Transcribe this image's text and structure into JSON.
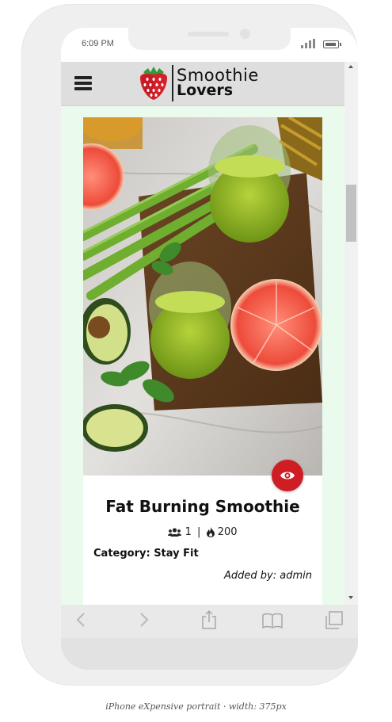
{
  "status": {
    "time": "6:09 PM"
  },
  "header": {
    "brand_line1": "Smoothie",
    "brand_line2": "Lovers",
    "menu_icon": "hamburger-icon",
    "logo_icon": "strawberry-icon"
  },
  "card": {
    "image_subject": "smoothie-jars-with-grapefruit-avocado-celery",
    "title": "Fat Burning Smoothie",
    "servings": "1",
    "separator": "|",
    "calories": "200",
    "category": "Category: Stay Fit",
    "added_by": "Added by: admin",
    "view_icon": "eye-icon"
  },
  "browser_toolbar": {
    "icons": [
      "back-arrow-icon",
      "forward-arrow-icon",
      "share-icon",
      "bookmarks-icon",
      "tabs-icon"
    ]
  },
  "colors": {
    "page_background": "#eafbee",
    "accent_red": "#cf1d24",
    "header_background": "#dedede"
  },
  "caption": "iPhone eXpensive portrait · width: 375px"
}
